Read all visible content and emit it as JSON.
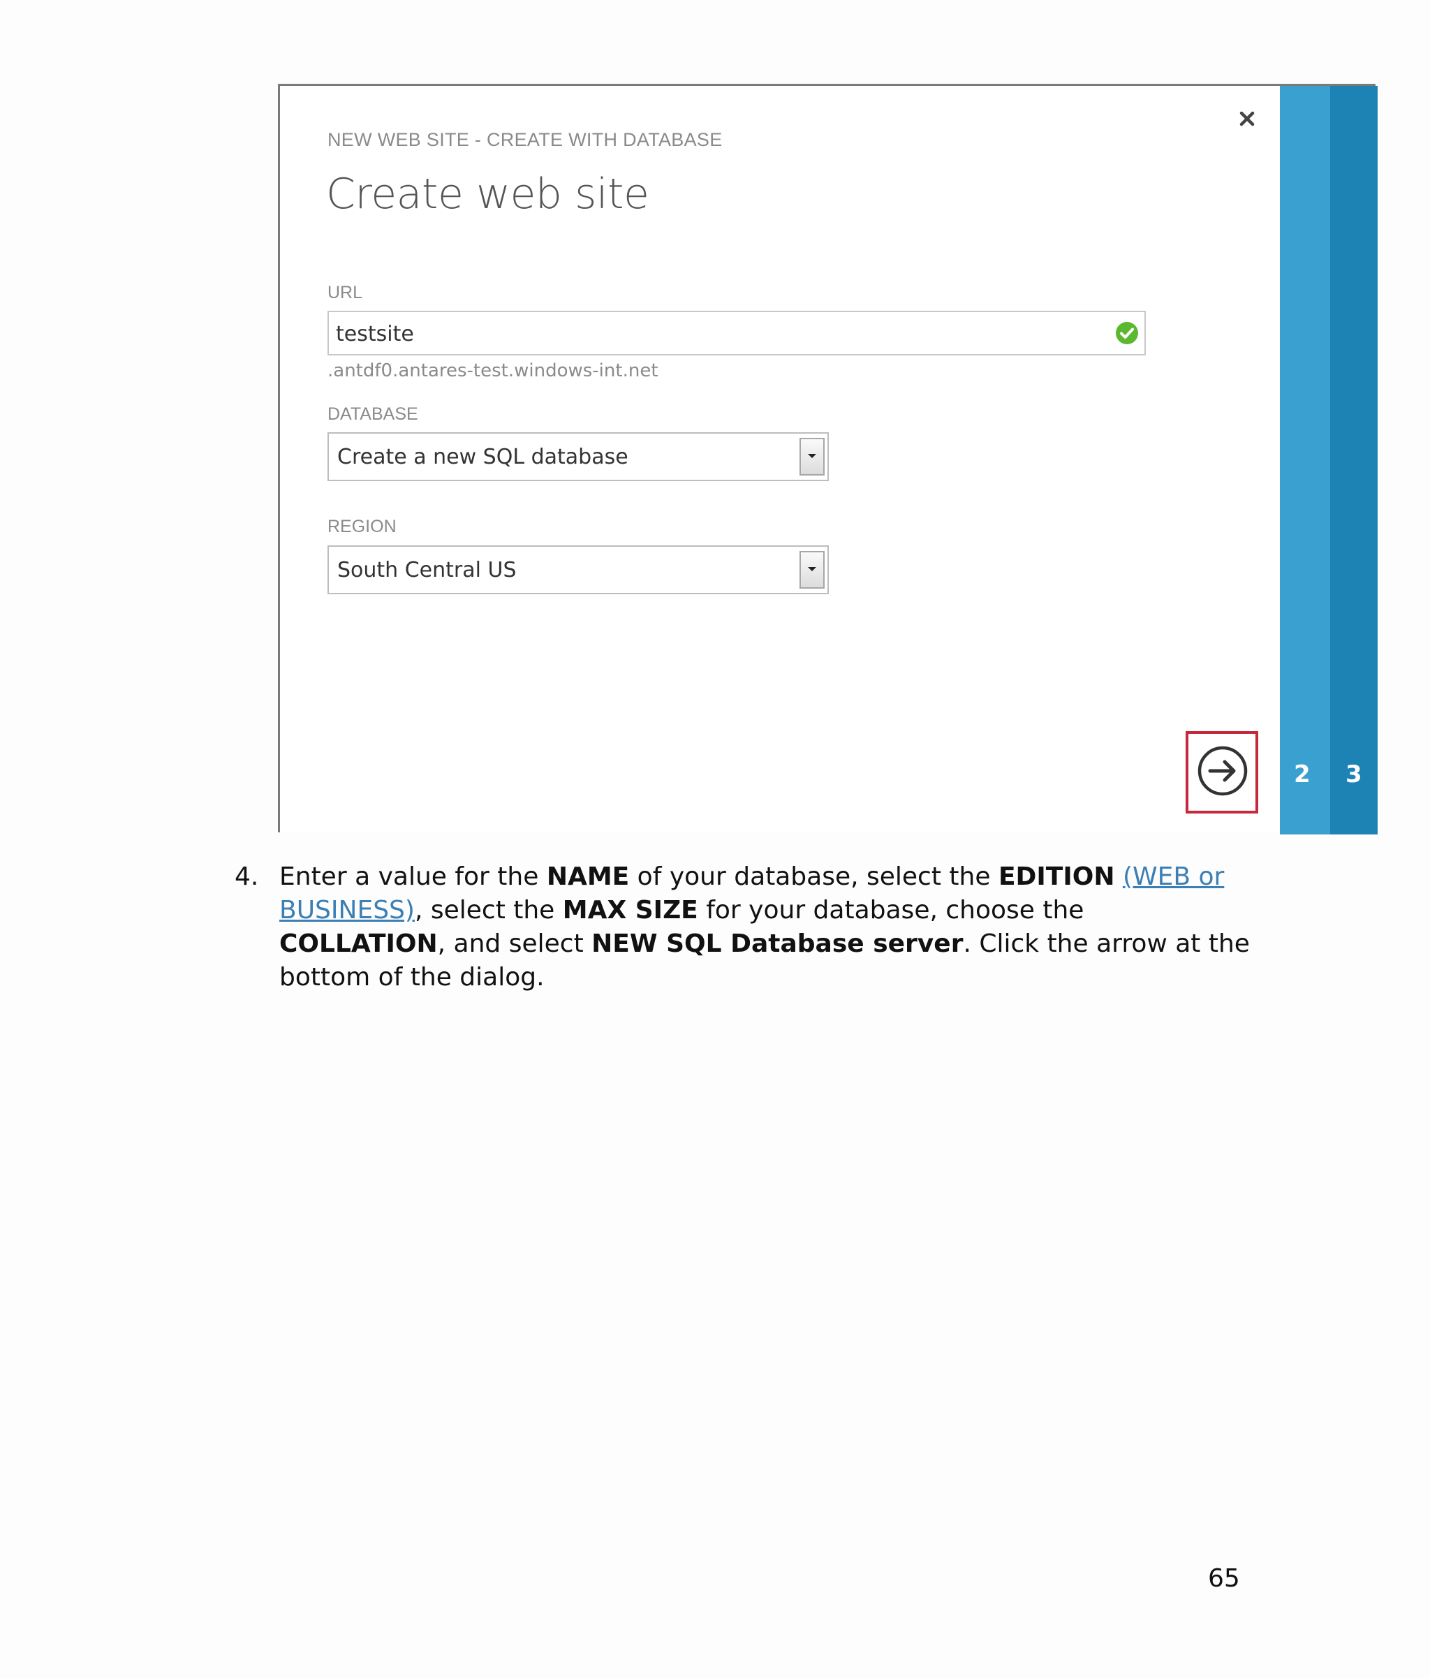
{
  "dialog": {
    "breadcrumb": "NEW WEB SITE - CREATE WITH DATABASE",
    "title": "Create web site",
    "url": {
      "label": "URL",
      "value": "testsite",
      "suffix": ".antdf0.antares-test.windows-int.net",
      "status_icon": "check-circle-icon"
    },
    "database": {
      "label": "DATABASE",
      "selected": "Create a new SQL database"
    },
    "region": {
      "label": "REGION",
      "selected": "South Central US"
    },
    "close_icon": "close-icon",
    "next_icon": "arrow-right-circle-icon",
    "steps": [
      "2",
      "3"
    ],
    "colors": {
      "step_light": "#39a0d0",
      "step_dark": "#1d83b4",
      "highlight": "#c8283c",
      "check": "#5cb82e"
    }
  },
  "instruction": {
    "number": "4.",
    "t1": "Enter a value for the ",
    "b1": "NAME",
    "t2": " of your database, select the ",
    "b2": "EDITION",
    "t3": " ",
    "link": "(WEB or BUSINESS)",
    "t4": ", select the ",
    "b3": "MAX SIZE",
    "t5": " for your database, choose the ",
    "b4": "COLLATION",
    "t6": ", and select ",
    "b5": "NEW SQL Database server",
    "t7": ". Click the arrow at the bottom of the dialog."
  },
  "page_number": "65"
}
